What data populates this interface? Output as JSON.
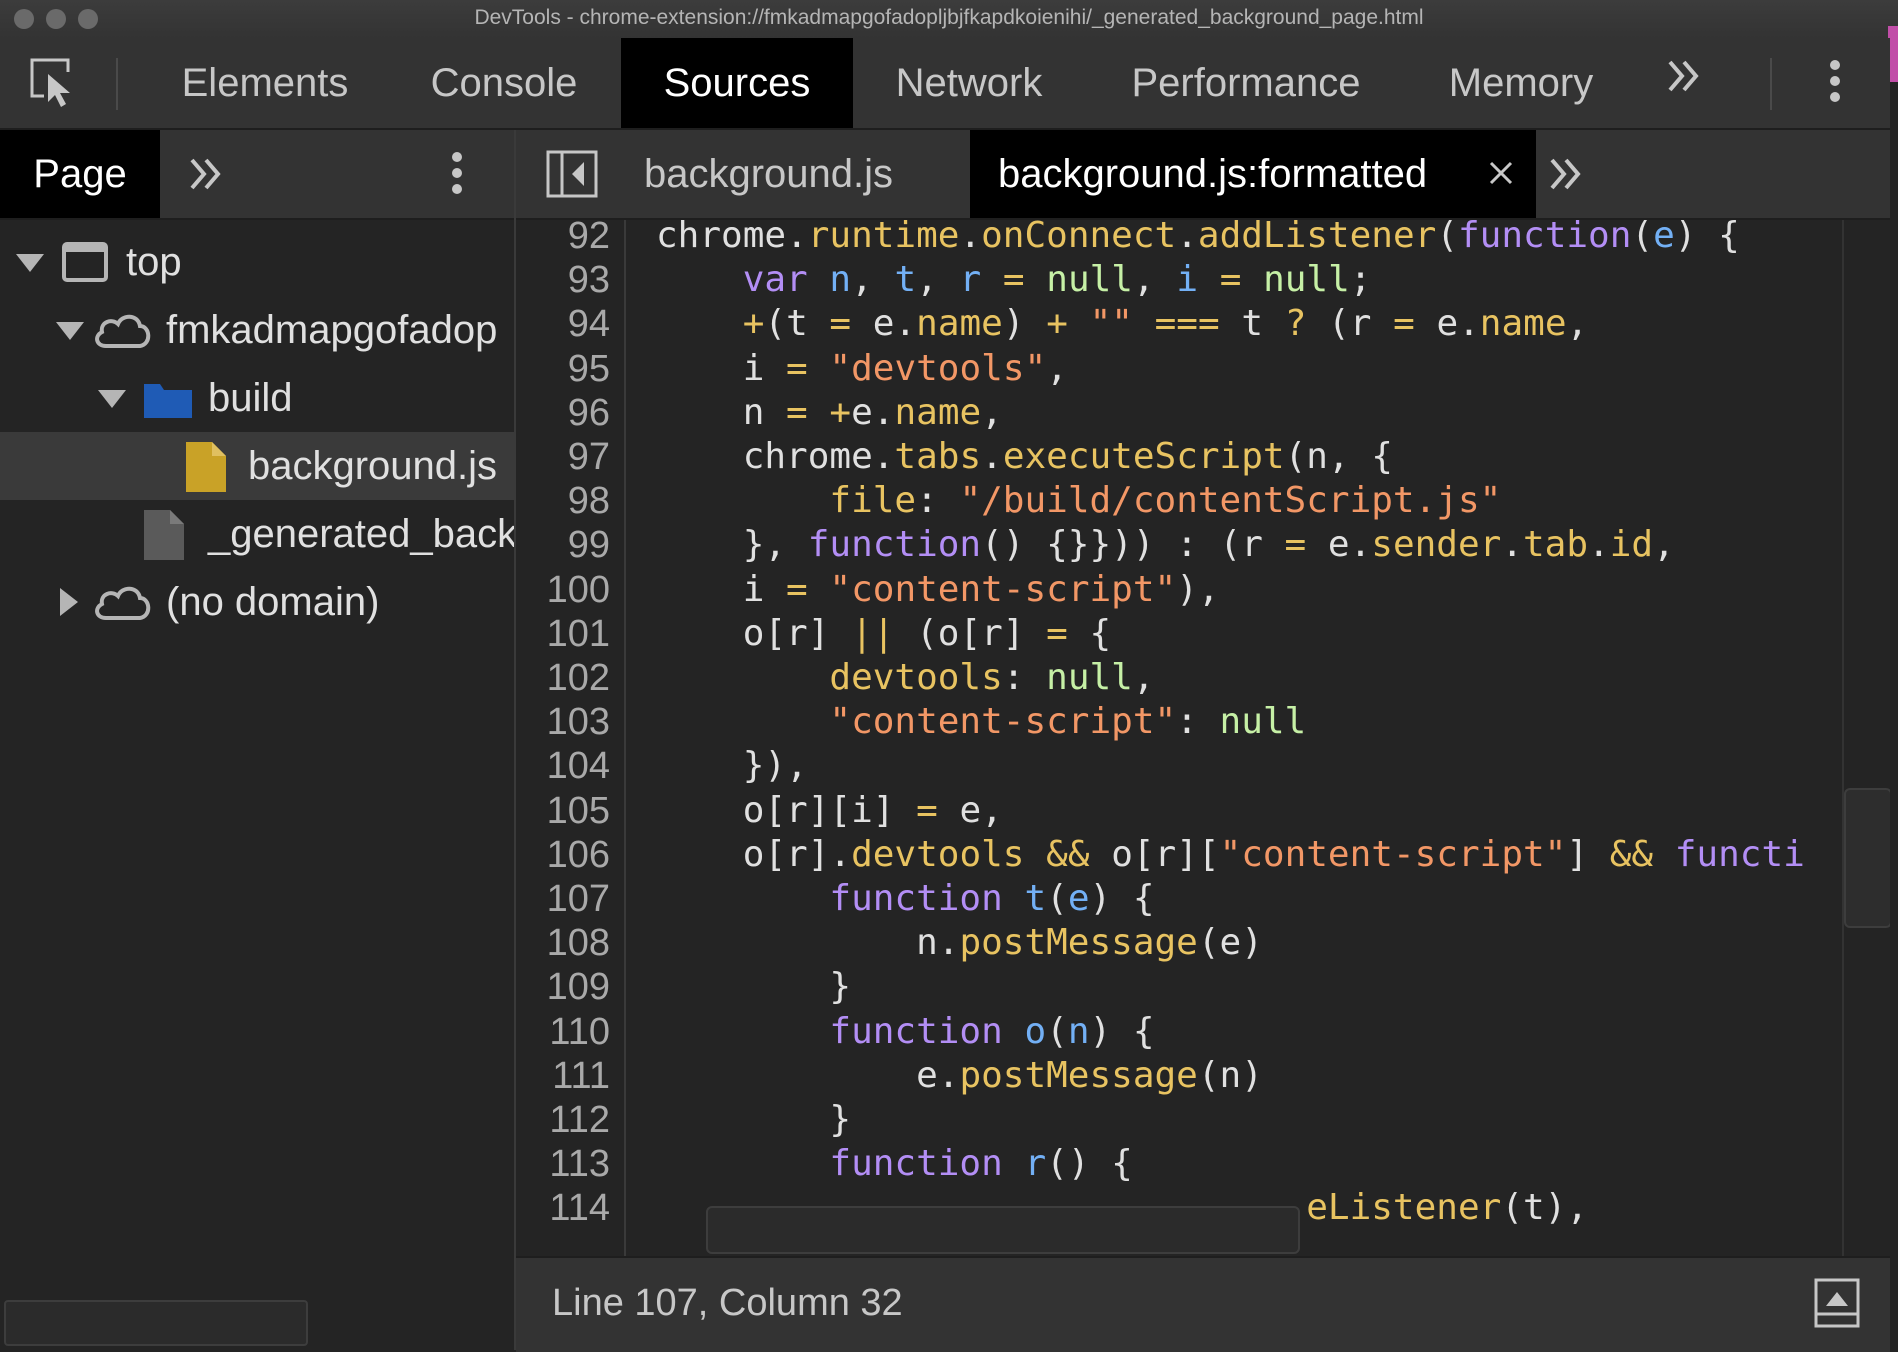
{
  "window": {
    "title": "DevTools - chrome-extension://fmkadmapgofadopljbjfkapdkoienihi/_generated_background_page.html"
  },
  "main_tabs": [
    {
      "label": "Elements",
      "active": false
    },
    {
      "label": "Console",
      "active": false
    },
    {
      "label": "Sources",
      "active": true
    },
    {
      "label": "Network",
      "active": false
    },
    {
      "label": "Performance",
      "active": false
    },
    {
      "label": "Memory",
      "active": false
    }
  ],
  "navigator": {
    "active_tab": "Page",
    "tree": [
      {
        "label": "top",
        "icon": "frame-icon",
        "expanded": true
      },
      {
        "label": "fmkadmapgofadop",
        "icon": "cloud-icon",
        "expanded": true
      },
      {
        "label": "build",
        "icon": "folder-icon",
        "expanded": true
      },
      {
        "label": "background.js",
        "icon": "file-js-icon",
        "selected": true
      },
      {
        "label": "_generated_back",
        "icon": "file-icon"
      },
      {
        "label": "(no domain)",
        "icon": "cloud-icon",
        "expanded": false
      }
    ]
  },
  "editor": {
    "tabs": [
      {
        "label": "background.js",
        "active": false
      },
      {
        "label": "background.js:formatted",
        "active": true,
        "closable": true
      }
    ],
    "line_numbers": [
      "92",
      "93",
      "94",
      "95",
      "96",
      "97",
      "98",
      "99",
      "100",
      "101",
      "102",
      "103",
      "104",
      "105",
      "106",
      "107",
      "108",
      "109",
      "110",
      "111",
      "112",
      "113",
      "114"
    ],
    "code_lines": [
      [
        [
          "p",
          "chrome."
        ],
        [
          "prop",
          "runtime"
        ],
        [
          "p",
          "."
        ],
        [
          "prop",
          "onConnect"
        ],
        [
          "p",
          "."
        ],
        [
          "prop",
          "addListener"
        ],
        [
          "p",
          "("
        ],
        [
          "kw",
          "function"
        ],
        [
          "p",
          "("
        ],
        [
          "var",
          "e"
        ],
        [
          "p",
          ") {"
        ]
      ],
      [
        [
          "p",
          "    "
        ],
        [
          "kw",
          "var"
        ],
        [
          "p",
          " "
        ],
        [
          "var",
          "n"
        ],
        [
          "p",
          ", "
        ],
        [
          "var",
          "t"
        ],
        [
          "p",
          ", "
        ],
        [
          "var",
          "r"
        ],
        [
          "p",
          " "
        ],
        [
          "op",
          "="
        ],
        [
          "p",
          " "
        ],
        [
          "null",
          "null"
        ],
        [
          "p",
          ", "
        ],
        [
          "var",
          "i"
        ],
        [
          "p",
          " "
        ],
        [
          "op",
          "="
        ],
        [
          "p",
          " "
        ],
        [
          "null",
          "null"
        ],
        [
          "p",
          ";"
        ]
      ],
      [
        [
          "p",
          "    "
        ],
        [
          "op",
          "+"
        ],
        [
          "p",
          "(t "
        ],
        [
          "op",
          "="
        ],
        [
          "p",
          " e."
        ],
        [
          "prop",
          "name"
        ],
        [
          "p",
          ") "
        ],
        [
          "op",
          "+"
        ],
        [
          "p",
          " "
        ],
        [
          "str",
          "\"\""
        ],
        [
          "p",
          " "
        ],
        [
          "op",
          "==="
        ],
        [
          "p",
          " t "
        ],
        [
          "op",
          "?"
        ],
        [
          "p",
          " (r "
        ],
        [
          "op",
          "="
        ],
        [
          "p",
          " e."
        ],
        [
          "prop",
          "name"
        ],
        [
          "p",
          ","
        ]
      ],
      [
        [
          "p",
          "    i "
        ],
        [
          "op",
          "="
        ],
        [
          "p",
          " "
        ],
        [
          "str",
          "\"devtools\""
        ],
        [
          "p",
          ","
        ]
      ],
      [
        [
          "p",
          "    n "
        ],
        [
          "op",
          "="
        ],
        [
          "p",
          " "
        ],
        [
          "op",
          "+"
        ],
        [
          "p",
          "e."
        ],
        [
          "prop",
          "name"
        ],
        [
          "p",
          ","
        ]
      ],
      [
        [
          "p",
          "    chrome."
        ],
        [
          "prop",
          "tabs"
        ],
        [
          "p",
          "."
        ],
        [
          "prop",
          "executeScript"
        ],
        [
          "p",
          "(n, {"
        ]
      ],
      [
        [
          "p",
          "        "
        ],
        [
          "prop",
          "file"
        ],
        [
          "p",
          ": "
        ],
        [
          "str",
          "\"/build/contentScript.js\""
        ]
      ],
      [
        [
          "p",
          "    }, "
        ],
        [
          "kw",
          "function"
        ],
        [
          "p",
          "() {}})) : (r "
        ],
        [
          "op",
          "="
        ],
        [
          "p",
          " e."
        ],
        [
          "prop",
          "sender"
        ],
        [
          "p",
          "."
        ],
        [
          "prop",
          "tab"
        ],
        [
          "p",
          "."
        ],
        [
          "prop",
          "id"
        ],
        [
          "p",
          ","
        ]
      ],
      [
        [
          "p",
          "    i "
        ],
        [
          "op",
          "="
        ],
        [
          "p",
          " "
        ],
        [
          "str",
          "\"content-script\""
        ],
        [
          "p",
          "),"
        ]
      ],
      [
        [
          "p",
          "    o[r] "
        ],
        [
          "op",
          "||"
        ],
        [
          "p",
          " (o[r] "
        ],
        [
          "op",
          "="
        ],
        [
          "p",
          " {"
        ]
      ],
      [
        [
          "p",
          "        "
        ],
        [
          "prop",
          "devtools"
        ],
        [
          "p",
          ": "
        ],
        [
          "null",
          "null"
        ],
        [
          "p",
          ","
        ]
      ],
      [
        [
          "p",
          "        "
        ],
        [
          "str",
          "\"content-script\""
        ],
        [
          "p",
          ": "
        ],
        [
          "null",
          "null"
        ]
      ],
      [
        [
          "p",
          "    }),"
        ]
      ],
      [
        [
          "p",
          "    o[r][i] "
        ],
        [
          "op",
          "="
        ],
        [
          "p",
          " e,"
        ]
      ],
      [
        [
          "p",
          "    o[r]."
        ],
        [
          "prop",
          "devtools"
        ],
        [
          "p",
          " "
        ],
        [
          "op",
          "&&"
        ],
        [
          "p",
          " o[r]["
        ],
        [
          "str",
          "\"content-script\""
        ],
        [
          "p",
          "] "
        ],
        [
          "op",
          "&&"
        ],
        [
          "p",
          " "
        ],
        [
          "kw",
          "functi"
        ]
      ],
      [
        [
          "p",
          "        "
        ],
        [
          "kw",
          "function"
        ],
        [
          "p",
          " "
        ],
        [
          "var",
          "t"
        ],
        [
          "p",
          "("
        ],
        [
          "var",
          "e"
        ],
        [
          "p",
          ") {"
        ]
      ],
      [
        [
          "p",
          "            n."
        ],
        [
          "prop",
          "postMessage"
        ],
        [
          "p",
          "(e)"
        ]
      ],
      [
        [
          "p",
          "        }"
        ]
      ],
      [
        [
          "p",
          "        "
        ],
        [
          "kw",
          "function"
        ],
        [
          "p",
          " "
        ],
        [
          "var",
          "o"
        ],
        [
          "p",
          "("
        ],
        [
          "var",
          "n"
        ],
        [
          "p",
          ") {"
        ]
      ],
      [
        [
          "p",
          "            e."
        ],
        [
          "prop",
          "postMessage"
        ],
        [
          "p",
          "(n)"
        ]
      ],
      [
        [
          "p",
          "        }"
        ]
      ],
      [
        [
          "p",
          "        "
        ],
        [
          "kw",
          "function"
        ],
        [
          "p",
          " "
        ],
        [
          "var",
          "r"
        ],
        [
          "p",
          "() {"
        ]
      ],
      [
        [
          "p",
          "            "
        ],
        [
          "p",
          "                  "
        ],
        [
          "prop",
          "eListener"
        ],
        [
          "p",
          "(t),"
        ]
      ]
    ]
  },
  "status": {
    "position": "Line 107, Column 32"
  },
  "colors": {
    "keyword": "#b38ef5",
    "property": "#e8c361",
    "string": "#f29766",
    "variable": "#73b0f5",
    "null": "#c6f0a6",
    "active_tab_bg": "#000000",
    "folder": "#1f5bb5",
    "js_file": "#c9a227"
  }
}
